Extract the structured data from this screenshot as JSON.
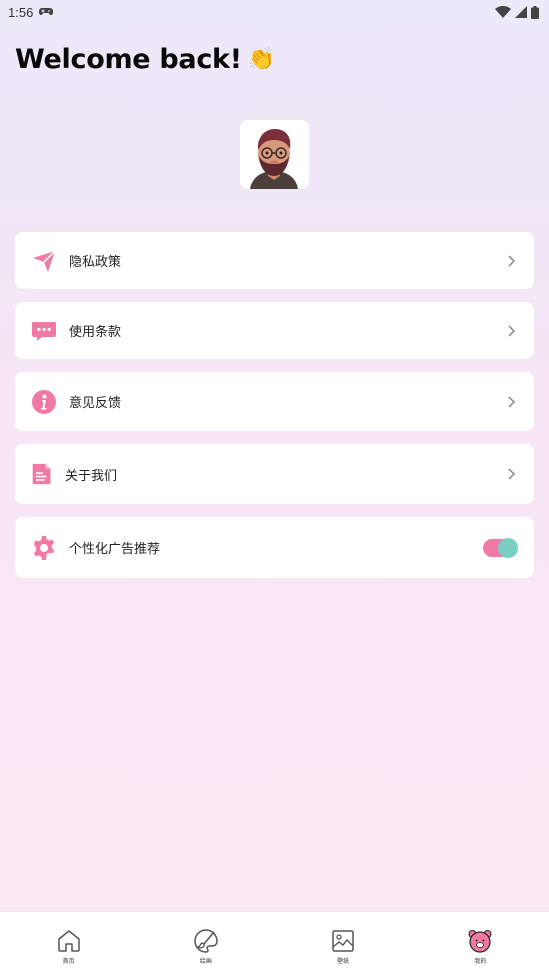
{
  "status_bar": {
    "time": "1:56"
  },
  "header": {
    "title": "Welcome back!",
    "emoji": "👏"
  },
  "menu": {
    "privacy": {
      "label": "隐私政策",
      "icon": "send-icon"
    },
    "terms": {
      "label": "使用条款",
      "icon": "chat-icon"
    },
    "feedback": {
      "label": "意见反馈",
      "icon": "info-icon"
    },
    "about": {
      "label": "关于我们",
      "icon": "document-icon"
    },
    "ads": {
      "label": "个性化广告推荐",
      "icon": "gear-icon",
      "enabled": true
    }
  },
  "tabs": [
    {
      "label": "首页",
      "icon": "home-icon"
    },
    {
      "label": "绘画",
      "icon": "palette-icon"
    },
    {
      "label": "壁纸",
      "icon": "image-icon"
    },
    {
      "label": "我的",
      "icon": "bear-icon",
      "active": true
    }
  ],
  "colors": {
    "accent": "#f07aa4",
    "toggle_knob": "#79cfc2"
  }
}
